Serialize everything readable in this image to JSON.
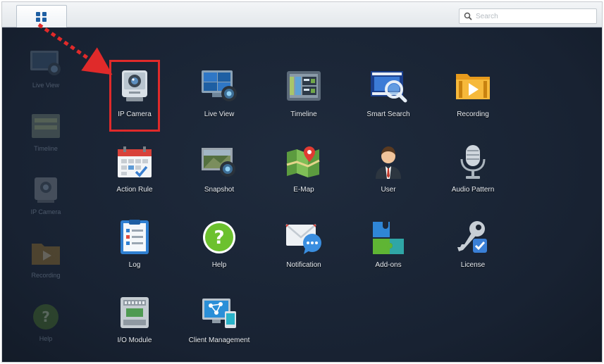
{
  "search": {
    "placeholder": "Search"
  },
  "main_menu": {
    "icon": "grid-icon"
  },
  "side_shortcuts": [
    {
      "label": "Live View",
      "icon": "live-view-icon"
    },
    {
      "label": "Timeline",
      "icon": "timeline-icon"
    },
    {
      "label": "IP Camera",
      "icon": "ip-camera-icon"
    },
    {
      "label": "Recording",
      "icon": "recording-icon"
    },
    {
      "label": "Help",
      "icon": "help-icon"
    }
  ],
  "apps": [
    {
      "label": "IP Camera",
      "icon": "ip-camera-icon",
      "highlighted": true
    },
    {
      "label": "Live View",
      "icon": "live-view-icon"
    },
    {
      "label": "Timeline",
      "icon": "timeline-icon"
    },
    {
      "label": "Smart Search",
      "icon": "smart-search-icon"
    },
    {
      "label": "Recording",
      "icon": "recording-icon"
    },
    {
      "label": "Action Rule",
      "icon": "action-rule-icon"
    },
    {
      "label": "Snapshot",
      "icon": "snapshot-icon"
    },
    {
      "label": "E-Map",
      "icon": "e-map-icon"
    },
    {
      "label": "User",
      "icon": "user-icon"
    },
    {
      "label": "Audio Pattern",
      "icon": "audio-pattern-icon"
    },
    {
      "label": "Log",
      "icon": "log-icon"
    },
    {
      "label": "Help",
      "icon": "help-icon"
    },
    {
      "label": "Notification",
      "icon": "notification-icon"
    },
    {
      "label": "Add-ons",
      "icon": "add-ons-icon"
    },
    {
      "label": "License",
      "icon": "license-icon"
    },
    {
      "label": "I/O Module",
      "icon": "io-module-icon"
    },
    {
      "label": "Client Management",
      "icon": "client-management-icon"
    }
  ],
  "colors": {
    "desktop_bg": "#1a2434",
    "highlight": "#e02a2a",
    "label_text": "#e8edf3",
    "topbar_bg": "#eef1f4"
  }
}
